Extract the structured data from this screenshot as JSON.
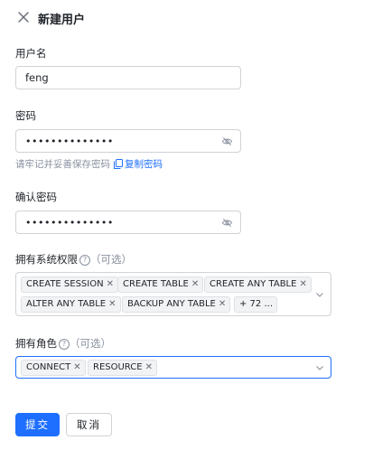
{
  "header": {
    "title": "新建用户",
    "close_icon": "close-icon"
  },
  "username": {
    "label": "用户名",
    "value": "feng"
  },
  "password": {
    "label": "密码",
    "value": "••••••••••••••",
    "hint": "请牢记并妥善保存密码",
    "copy_label": "复制密码",
    "visibility_icon": "eye-off-icon"
  },
  "confirm_password": {
    "label": "确认密码",
    "value": "••••••••••••••",
    "visibility_icon": "eye-off-icon"
  },
  "system_privileges": {
    "label": "拥有系统权限",
    "optional": "（可选）",
    "tags": [
      "CREATE SESSION",
      "CREATE TABLE",
      "CREATE ANY TABLE",
      "ALTER ANY TABLE",
      "BACKUP ANY TABLE"
    ],
    "more": "+ 72 ..."
  },
  "roles": {
    "label": "拥有角色",
    "optional": "（可选）",
    "tags": [
      "CONNECT",
      "RESOURCE"
    ]
  },
  "actions": {
    "submit": "提交",
    "cancel": "取消"
  },
  "colors": {
    "primary": "#1e6fff",
    "border": "#d0d3d6",
    "tag_bg": "#f2f3f5",
    "muted": "#8a919f"
  }
}
